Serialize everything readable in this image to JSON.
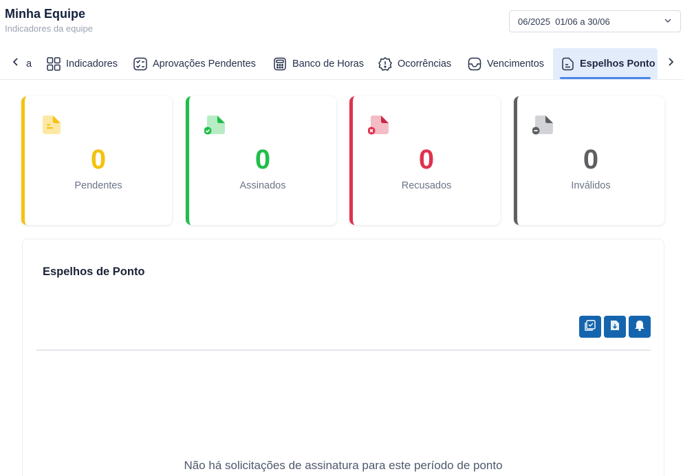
{
  "header": {
    "title": "Minha Equipe",
    "subtitle": "Indicadores da equipe",
    "period_select": {
      "value": "06/2025  01/06 a 30/06"
    }
  },
  "tabs": {
    "partial_label": "a",
    "items": [
      {
        "label": "Indicadores",
        "icon": "grid-icon"
      },
      {
        "label": "Aprovações Pendentes",
        "icon": "checklist-icon"
      },
      {
        "label": "Banco de Horas",
        "icon": "calculator-icon"
      },
      {
        "label": "Ocorrências",
        "icon": "alert-badge-icon"
      },
      {
        "label": "Vencimentos",
        "icon": "inbox-icon"
      },
      {
        "label": "Espelhos Ponto",
        "icon": "document-icon",
        "active": true
      }
    ]
  },
  "cards": [
    {
      "value": "0",
      "label": "Pendentes",
      "color": "#f5c10e",
      "icon": "document-pending-icon"
    },
    {
      "value": "0",
      "label": "Assinados",
      "color": "#1fbe4a",
      "icon": "document-check-icon"
    },
    {
      "value": "0",
      "label": "Recusados",
      "color": "#e0314f",
      "icon": "document-x-icon"
    },
    {
      "value": "0",
      "label": "Inválidos",
      "color": "#5d5f63",
      "icon": "document-minus-icon"
    }
  ],
  "panel": {
    "title": "Espelhos de Ponto",
    "actions": [
      "select-all-icon",
      "download-document-icon",
      "bell-icon"
    ],
    "empty_message": "Não há solicitações de assinatura para este período de ponto"
  },
  "colors": {
    "accent": "#4b86ea",
    "action_button": "#1565ae",
    "active_tab_bg": "#e3ecfb"
  }
}
